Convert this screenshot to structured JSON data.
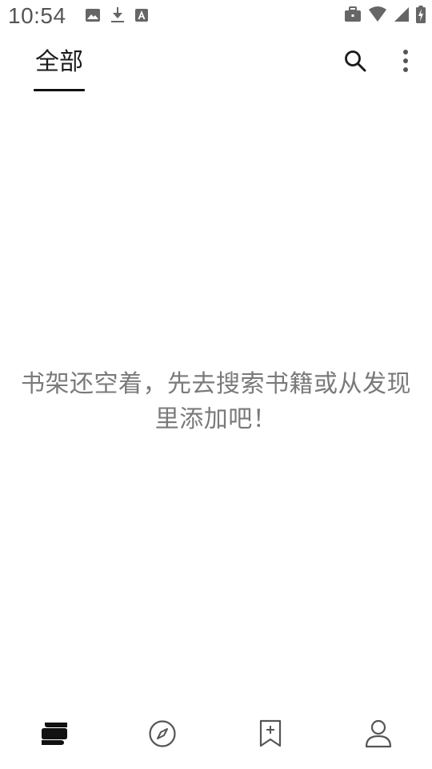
{
  "status_bar": {
    "time": "10:54",
    "left_icons": [
      "image-icon",
      "download-icon",
      "font-icon"
    ],
    "right_icons": [
      "briefcase-icon",
      "wifi-icon",
      "cellular-signal-icon",
      "battery-charging-icon"
    ]
  },
  "top_bar": {
    "tabs": [
      {
        "label": "全部",
        "selected": true
      }
    ],
    "actions": [
      "search-icon",
      "more-vert-icon"
    ]
  },
  "empty_state": {
    "message": "书架还空着，先去搜索书籍或从发现里添加吧！"
  },
  "bottom_nav": {
    "items": [
      {
        "icon": "bookshelf-icon",
        "selected": true
      },
      {
        "icon": "compass-icon",
        "selected": false
      },
      {
        "icon": "bookmark-add-icon",
        "selected": false
      },
      {
        "icon": "profile-icon",
        "selected": false
      }
    ]
  },
  "colors": {
    "background": "#ffffff",
    "text_primary": "#1a1a1a",
    "text_secondary": "#7a7a7a",
    "icon_active": "#111111",
    "icon_inactive": "#555555"
  }
}
